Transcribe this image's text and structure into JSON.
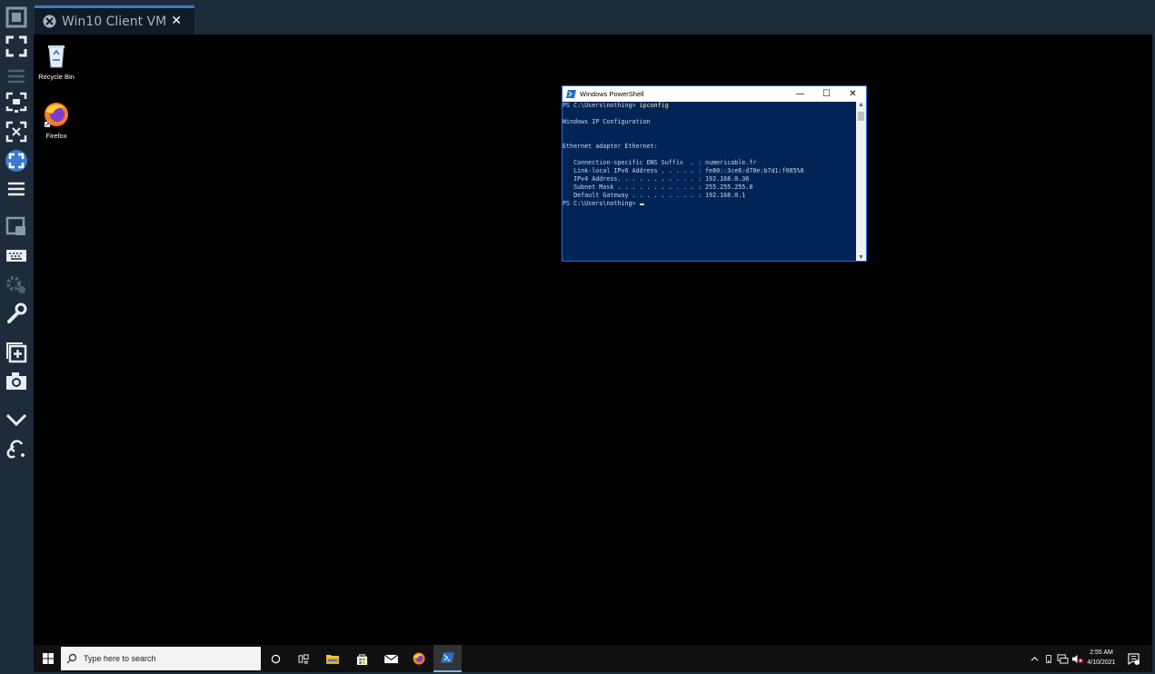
{
  "toolbar": {
    "items": [
      {
        "icon": "fit-window-icon"
      },
      {
        "icon": "fullscreen-icon"
      },
      {
        "icon": "hamburger-dim-icon"
      },
      {
        "icon": "scale-monitor-icon"
      },
      {
        "icon": "dynamic-resize-icon"
      },
      {
        "icon": "auto-fit-icon"
      },
      {
        "icon": "menu-icon"
      },
      {
        "icon": "picture-in-picture-icon"
      },
      {
        "icon": "keyboard-icon"
      },
      {
        "icon": "settings-icon"
      },
      {
        "icon": "wrench-icon"
      },
      {
        "icon": "new-window-icon"
      },
      {
        "icon": "camera-icon"
      },
      {
        "icon": "chevron-down-icon"
      },
      {
        "icon": "disconnect-icon"
      }
    ]
  },
  "tab": {
    "title": "Win10 Client VM",
    "close": "✕"
  },
  "desktop": {
    "icons": [
      {
        "label": "Recycle Bin"
      },
      {
        "label": "Firefox"
      }
    ]
  },
  "powershell": {
    "title": "Windows PowerShell",
    "minimize": "—",
    "maximize": "☐",
    "close": "✕",
    "lines": {
      "prompt1": "PS C:\\Users\\nothing> ",
      "command": "ipconfig",
      "blank1": "",
      "header": "Windows IP Configuration",
      "blank2": "",
      "blank3": "",
      "adapter": "Ethernet adapter Ethernet:",
      "blank4": "",
      "dns": "   Connection-specific DNS Suffix  . : numericable.fr",
      "ipv6": "   Link-local IPv6 Address . . . . . : fe80::3ce6:d70e:b7d1:f085%6",
      "ipv4": "   IPv4 Address. . . . . . . . . . . : 192.168.0.36",
      "mask": "   Subnet Mask . . . . . . . . . . . : 255.255.255.0",
      "gw": "   Default Gateway . . . . . . . . . : 192.168.0.1",
      "prompt2": "PS C:\\Users\\nothing> "
    }
  },
  "taskbar": {
    "search_placeholder": "Type here to search",
    "clock_time": "2:55 AM",
    "clock_date": "4/10/2021"
  }
}
